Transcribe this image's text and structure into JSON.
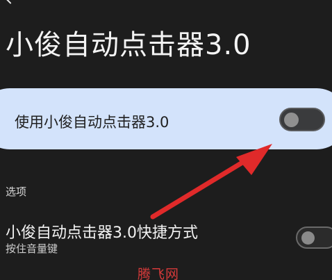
{
  "header": {
    "title": "小俊自动点击器3.0"
  },
  "main_switch": {
    "label": "使用小俊自动点击器3.0",
    "enabled": false
  },
  "options": {
    "section_label": "选项",
    "shortcut": {
      "title": "小俊自动点击器3.0快捷方式",
      "subtitle": "按住音量键",
      "enabled": false
    }
  },
  "watermark": {
    "text": "腾飞网"
  },
  "colors": {
    "background": "#1d1d1d",
    "card": "#d3e3fb",
    "arrow": "#e02a2a",
    "watermark": "#d63a3a"
  }
}
